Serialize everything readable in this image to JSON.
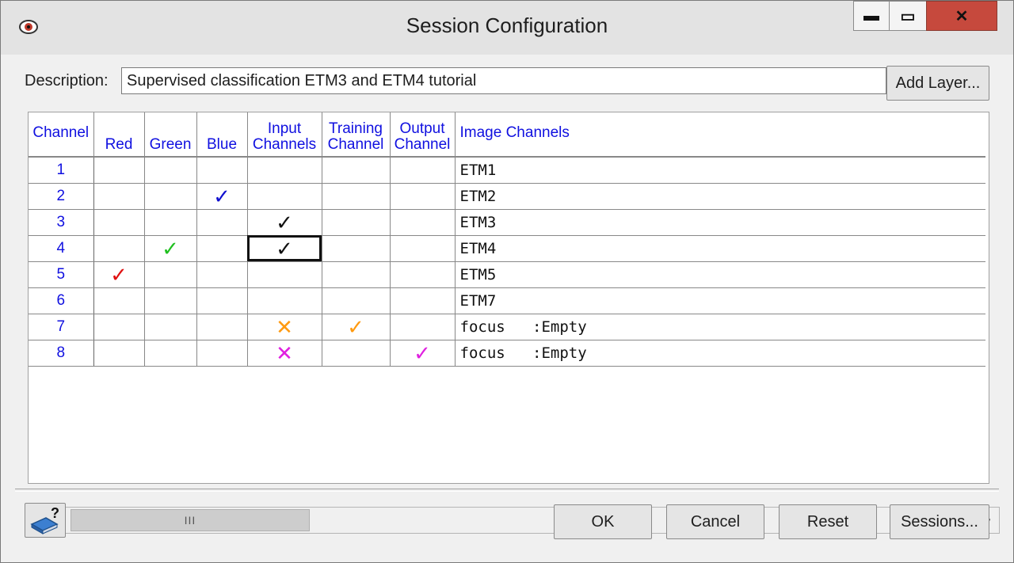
{
  "window": {
    "title": "Session Configuration",
    "controls": {
      "minimize": "▬",
      "maximize": "▭",
      "close": "✕"
    }
  },
  "description": {
    "label": "Description:",
    "value": "Supervised classification ETM3 and ETM4 tutorial",
    "add_layer_label": "Add Layer..."
  },
  "grid": {
    "headers": [
      "Channel",
      "Red",
      "Green",
      "Blue",
      "Input Channels",
      "Training Channel",
      "Output Channel",
      "Image Channels"
    ],
    "header_color": "#1010e0",
    "rows": [
      {
        "channel": "1",
        "red": "",
        "green": "",
        "blue": "",
        "input": "",
        "training": "",
        "output": "",
        "image_channel": "ETM1"
      },
      {
        "channel": "2",
        "red": "",
        "green": "",
        "blue": "✓",
        "input": "",
        "training": "",
        "output": "",
        "image_channel": "ETM2"
      },
      {
        "channel": "3",
        "red": "",
        "green": "",
        "blue": "",
        "input": "✓",
        "training": "",
        "output": "",
        "image_channel": "ETM3"
      },
      {
        "channel": "4",
        "red": "",
        "green": "✓",
        "blue": "",
        "input": "✓",
        "training": "",
        "output": "",
        "image_channel": "ETM4"
      },
      {
        "channel": "5",
        "red": "✓",
        "green": "",
        "blue": "",
        "input": "",
        "training": "",
        "output": "",
        "image_channel": "ETM5"
      },
      {
        "channel": "6",
        "red": "",
        "green": "",
        "blue": "",
        "input": "",
        "training": "",
        "output": "",
        "image_channel": "ETM7"
      },
      {
        "channel": "7",
        "red": "",
        "green": "",
        "blue": "",
        "input": "✕",
        "training": "✓",
        "output": "",
        "image_channel": "focus   :Empty"
      },
      {
        "channel": "8",
        "red": "",
        "green": "",
        "blue": "",
        "input": "✕",
        "training": "",
        "output": "✓",
        "image_channel": "focus   :Empty"
      }
    ],
    "colors": {
      "red_check": "#e01010",
      "green_check": "#20c020",
      "blue_check": "#1010d0",
      "input_check": "#111111",
      "row7_mark": "#ff9a10",
      "row8_mark": "#e020e0"
    },
    "selected_cell": {
      "row": "4",
      "column": "Input Channels"
    }
  },
  "scrollbar": {
    "left_arrow": "<",
    "right_arrow": ">",
    "thumb_grip": "III"
  },
  "buttons": {
    "help_icon": "help-book-icon",
    "ok": "OK",
    "cancel": "Cancel",
    "reset": "Reset",
    "sessions": "Sessions..."
  }
}
